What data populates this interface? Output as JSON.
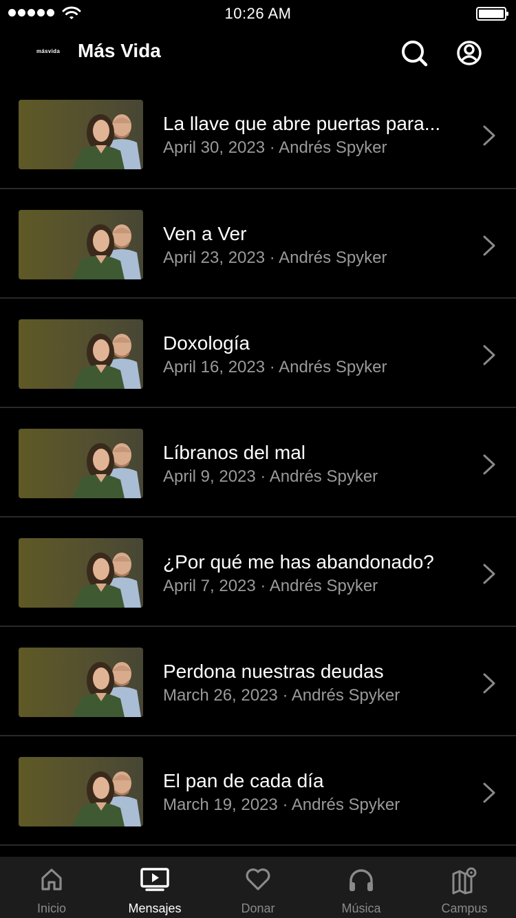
{
  "status_bar": {
    "time": "10:26 AM",
    "signal_icon": "signal-dots-icon",
    "wifi_icon": "wifi-icon",
    "battery_icon": "battery-icon"
  },
  "header": {
    "logo_text": "másvida",
    "title": "Más Vida",
    "search_icon": "search-icon",
    "account_icon": "account-icon"
  },
  "messages": [
    {
      "title": "La llave que abre puertas para...",
      "meta": "April 30, 2023 · Andrés Spyker"
    },
    {
      "title": "Ven a Ver",
      "meta": "April 23, 2023 · Andrés Spyker"
    },
    {
      "title": "Doxología",
      "meta": "April 16, 2023 · Andrés Spyker"
    },
    {
      "title": "Líbranos del mal",
      "meta": "April 9, 2023 · Andrés Spyker"
    },
    {
      "title": "¿Por qué me has abandonado?",
      "meta": "April 7, 2023 · Andrés Spyker"
    },
    {
      "title": "Perdona nuestras deudas",
      "meta": "March 26, 2023 · Andrés Spyker"
    },
    {
      "title": "El pan de cada día",
      "meta": "March 19, 2023 · Andrés Spyker"
    }
  ],
  "tabs": [
    {
      "label": "Inicio",
      "icon": "home-icon",
      "active": false
    },
    {
      "label": "Mensajes",
      "icon": "tv-play-icon",
      "active": true
    },
    {
      "label": "Donar",
      "icon": "heart-icon",
      "active": false
    },
    {
      "label": "Música",
      "icon": "headphones-icon",
      "active": false
    },
    {
      "label": "Campus",
      "icon": "map-pin-icon",
      "active": false
    }
  ],
  "colors": {
    "background": "#000000",
    "tab_bar": "#1c1c1c",
    "text_primary": "#ffffff",
    "text_secondary": "#9a9a9a",
    "tab_inactive": "#8a8a8a",
    "divider": "#2a2a2a"
  }
}
